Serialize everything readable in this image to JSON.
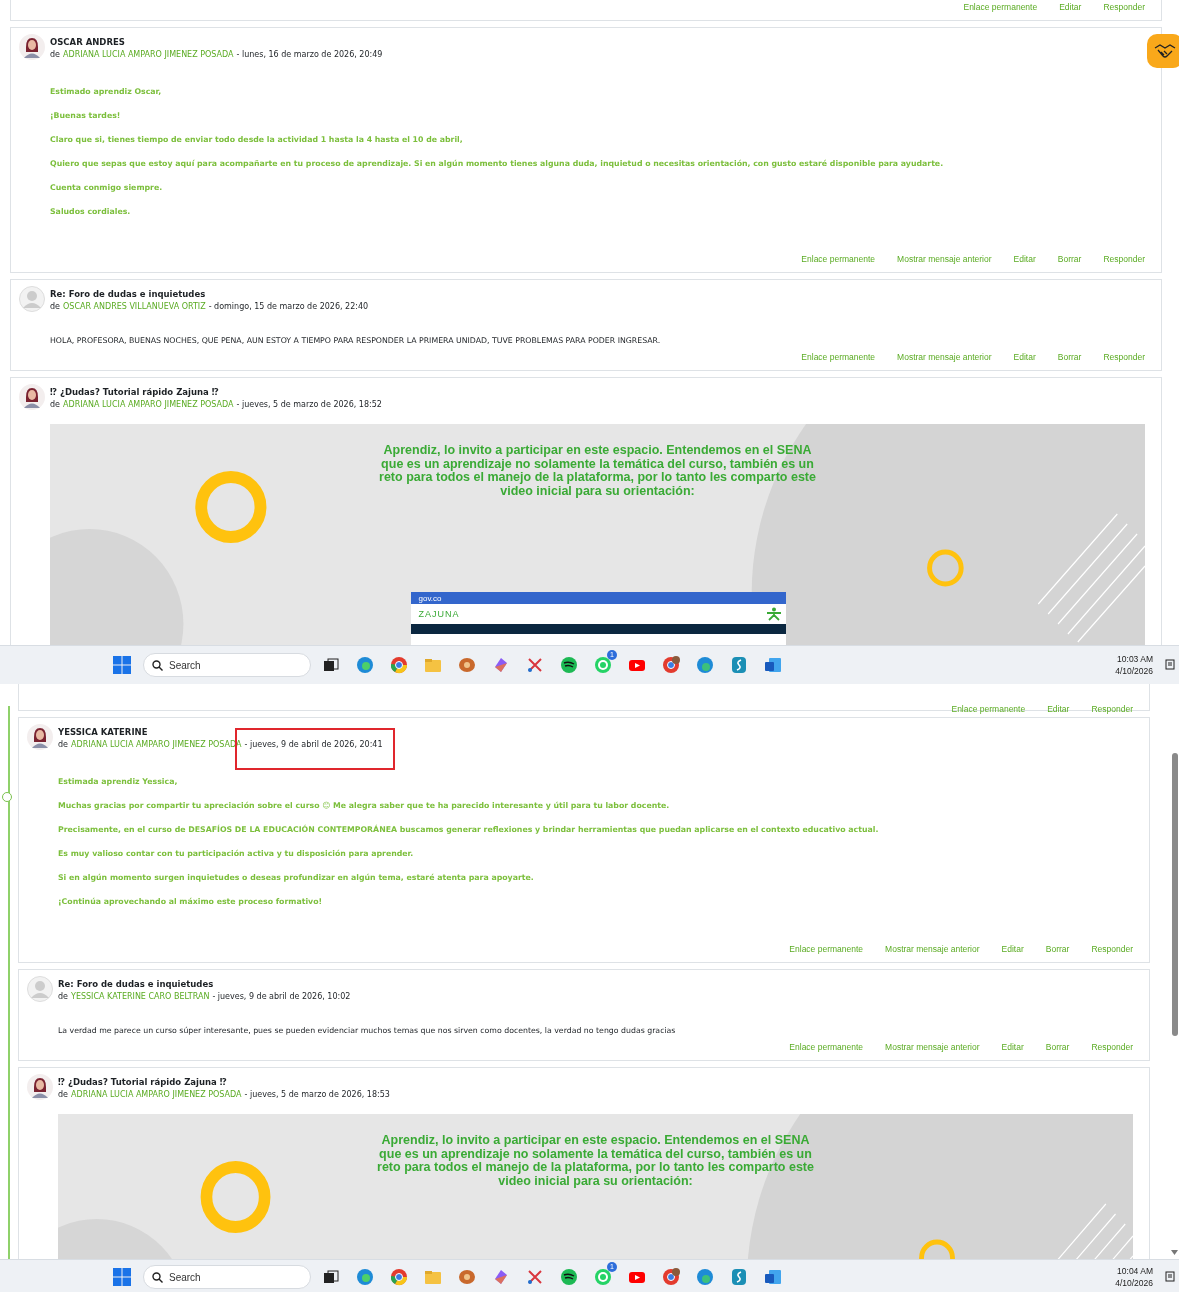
{
  "screens": [
    {
      "help_button": true,
      "timeline": false,
      "scrollbar": false,
      "page": {
        "top_actions": [
          "Enlace permanente",
          "Editar",
          "Responder"
        ],
        "posts": [
          {
            "kind": "teacher",
            "photo": true,
            "subject": "OSCAR ANDRES",
            "by": "de",
            "author": "ADRIANA LUCIA AMPARO JIMENEZ POSADA",
            "date": "- lunes, 16 de marzo de 2026, 20:49",
            "highlighted": false,
            "body": [
              "Estimado aprendiz Oscar,",
              "¡Buenas tardes!",
              "Claro que si, tienes tiempo de enviar todo desde la actividad 1 hasta la 4 hasta el 10 de abril,",
              "Quiero que sepas que estoy aquí para acompañarte en tu proceso de aprendizaje. Si en algún momento tienes alguna duda, inquietud o necesitas orientación, con gusto estaré disponible para ayudarte.",
              "Cuenta conmigo siempre.",
              "Saludos cordiales."
            ],
            "actions": [
              "Enlace permanente",
              "Mostrar mensaje anterior",
              "Editar",
              "Borrar",
              "Responder"
            ]
          },
          {
            "kind": "student",
            "photo": false,
            "subject": "Re: Foro de dudas e inquietudes",
            "by": "de",
            "author": "OSCAR ANDRES VILLANUEVA ORTIZ",
            "date": "- domingo, 15 de marzo de 2026, 22:40",
            "highlighted": false,
            "body": [
              "HOLA, PROFESORA, BUENAS NOCHES, QUE PENA, AUN ESTOY A TIEMPO PARA RESPONDER LA PRIMERA UNIDAD, TUVE PROBLEMAS PARA PODER INGRESAR."
            ],
            "actions": [
              "Enlace permanente",
              "Mostrar mensaje anterior",
              "Editar",
              "Borrar",
              "Responder"
            ]
          },
          {
            "kind": "banner",
            "photo": true,
            "subject": "⁉ ¿Dudas? Tutorial rápido Zajuna ⁉",
            "by": "de",
            "author": "ADRIANA LUCIA AMPARO JIMENEZ POSADA",
            "date": "- jueves, 5 de marzo de 2026, 18:52",
            "highlighted": false,
            "banner": {
              "text": "Aprendiz, lo invito a participar en este espacio.  Entendemos en el SENA que es un aprendizaje no solamente la temática del curso, también es un reto para todos el manejo de la plataforma, por lo tanto les comparto este video inicial para su orientación:",
              "site": {
                "domain": "gov.co",
                "logo": "ZAJUNA"
              }
            }
          }
        ]
      },
      "taskbar": {
        "search": "Search",
        "badge": "1",
        "time": "10:03 AM",
        "date": "4/10/2026"
      }
    },
    {
      "help_button": false,
      "timeline": true,
      "scrollbar": true,
      "page": {
        "top_actions": [
          "Enlace permanente",
          "Editar",
          "Responder"
        ],
        "posts": [
          {
            "kind": "teacher",
            "photo": true,
            "subject": "YESSICA KATERINE",
            "by": "de",
            "author": "ADRIANA LUCIA AMPARO JIMENEZ POSADA",
            "date": "- jueves, 9 de abril de 2026, 20:41",
            "highlighted": true,
            "body": [
              "Estimada aprendiz Yessica,",
              "Muchas gracias por compartir tu apreciación sobre el curso 😊 Me alegra saber que te ha parecido interesante y útil para tu labor docente.",
              "Precisamente, en el curso de DESAFÍOS DE LA EDUCACIÓN CONTEMPORÁNEA buscamos generar reflexiones y brindar herramientas que puedan aplicarse en el contexto educativo actual.",
              "Es muy valioso contar con tu participación activa y tu disposición para aprender.",
              "Si en algún momento surgen inquietudes o deseas profundizar en algún tema, estaré atenta para apoyarte.",
              "¡Continúa aprovechando al máximo este proceso formativo!"
            ],
            "actions": [
              "Enlace permanente",
              "Mostrar mensaje anterior",
              "Editar",
              "Borrar",
              "Responder"
            ]
          },
          {
            "kind": "student",
            "photo": false,
            "subject": "Re: Foro de dudas e inquietudes",
            "by": "de",
            "author": "YESSICA KATERINE CARO BELTRAN",
            "date": "- jueves, 9 de abril de 2026, 10:02",
            "highlighted": false,
            "body": [
              "La verdad me parece un curso súper interesante, pues se pueden evidenciar muchos temas que nos sirven como docentes, la verdad no tengo dudas gracias"
            ],
            "actions": [
              "Enlace permanente",
              "Mostrar mensaje anterior",
              "Editar",
              "Borrar",
              "Responder"
            ]
          },
          {
            "kind": "banner",
            "photo": true,
            "subject": "⁉ ¿Dudas? Tutorial rápido Zajuna ⁉",
            "by": "de",
            "author": "ADRIANA LUCIA AMPARO JIMENEZ POSADA",
            "date": "- jueves, 5 de marzo de 2026, 18:53",
            "highlighted": false,
            "banner": {
              "text": "Aprendiz, lo invito a participar en este espacio.  Entendemos en el SENA que es un aprendizaje no solamente la temática del curso, también es un reto para todos el manejo de la plataforma, por lo tanto les comparto este video inicial para su orientación:"
            }
          }
        ]
      },
      "taskbar": {
        "search": "Search",
        "badge": "1",
        "time": "10:04 AM",
        "date": "4/10/2026"
      }
    }
  ]
}
